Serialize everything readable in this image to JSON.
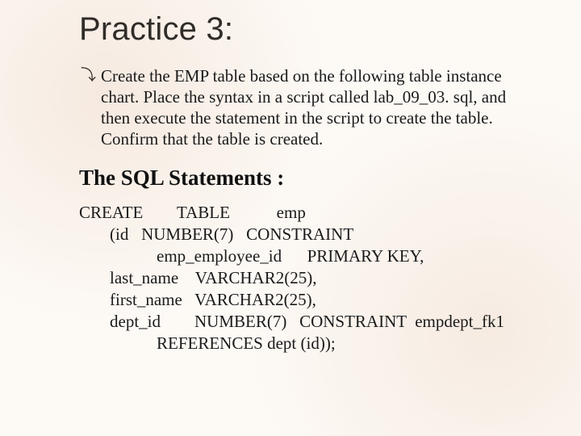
{
  "title": "Practice 3:",
  "bullet": {
    "glyph": "⤵",
    "text": "Create the EMP table based on the following table instance chart. Place the syntax in a script called lab_09_03. sql, and then execute the statement in the script to create the table. Confirm that the table is created."
  },
  "subheading": "The SQL Statements :",
  "sql": {
    "lines": [
      "CREATE        TABLE           emp",
      "(id   NUMBER(7)   CONSTRAINT",
      "emp_employee_id      PRIMARY KEY,",
      "last_name    VARCHAR2(25),",
      "first_name   VARCHAR2(25),",
      "dept_id        NUMBER(7)   CONSTRAINT  empdept_fk1",
      "REFERENCES dept (id));"
    ]
  }
}
